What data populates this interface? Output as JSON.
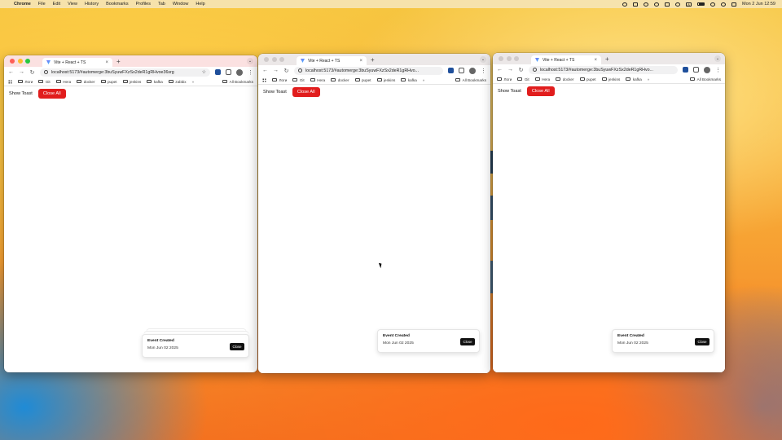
{
  "menubar": {
    "app": "Chrome",
    "items": [
      "File",
      "Edit",
      "View",
      "History",
      "Bookmarks",
      "Profiles",
      "Tab",
      "Window",
      "Help"
    ],
    "clock": "Mon 2 Jun  12:59",
    "input_indicator": "A"
  },
  "windows": [
    {
      "tab_title": "Vite + React + TS",
      "url": "localhost:5173/#automerge:3buSyuwFXzSx2deR1gRHvoe36srg",
      "bookmarks": [
        "Логи",
        "Git",
        "Нега",
        "docker",
        "pupet",
        "jenkins",
        "kafka",
        "zabbix"
      ],
      "all_bookmarks": "All Bookmarks",
      "show_toast": "Show Toast",
      "close_all": "Close All",
      "toast": {
        "title": "Event Created",
        "description": "Mon Jun 02 2025",
        "close": "Close"
      }
    },
    {
      "tab_title": "Vite + React + TS",
      "url": "localhost:5173/#automerge:3buSyuwFXzSx2deR1gRHvo...",
      "bookmarks": [
        "Логи",
        "Git",
        "Нега",
        "docker",
        "pupet",
        "jenkins",
        "kafka"
      ],
      "all_bookmarks": "All Bookmarks",
      "show_toast": "Show Toast",
      "close_all": "Close All",
      "toast": {
        "title": "Event Created",
        "description": "Mon Jun 02 2025",
        "close": "Close"
      }
    },
    {
      "tab_title": "Vite + React + TS",
      "url": "localhost:5173/#automerge:3buSyuwFXzSx2deR1gRHvo...",
      "bookmarks": [
        "Логи",
        "Git",
        "Нега",
        "docker",
        "pupet",
        "jenkins",
        "kafka"
      ],
      "all_bookmarks": "All Bookmarks",
      "show_toast": "Show Toast",
      "close_all": "Close All",
      "toast": {
        "title": "Event Created",
        "description": "Mon Jun 02 2025",
        "close": "Close"
      }
    }
  ],
  "icons": [
    "apple-icon",
    "info-icon",
    "star-icon",
    "extension-icon",
    "puzzle-icon",
    "avatar",
    "kebab-menu-icon",
    "folder-icon",
    "apps-grid-icon",
    "back-arrow-icon",
    "forward-arrow-icon",
    "reload-icon",
    "tab-search-icon"
  ],
  "colors": {
    "close_all_button": "#e11d1d",
    "toast_close_button": "#111111",
    "active_titlebar": "#fbe1e1",
    "inactive_titlebar": "#ece8e8"
  }
}
